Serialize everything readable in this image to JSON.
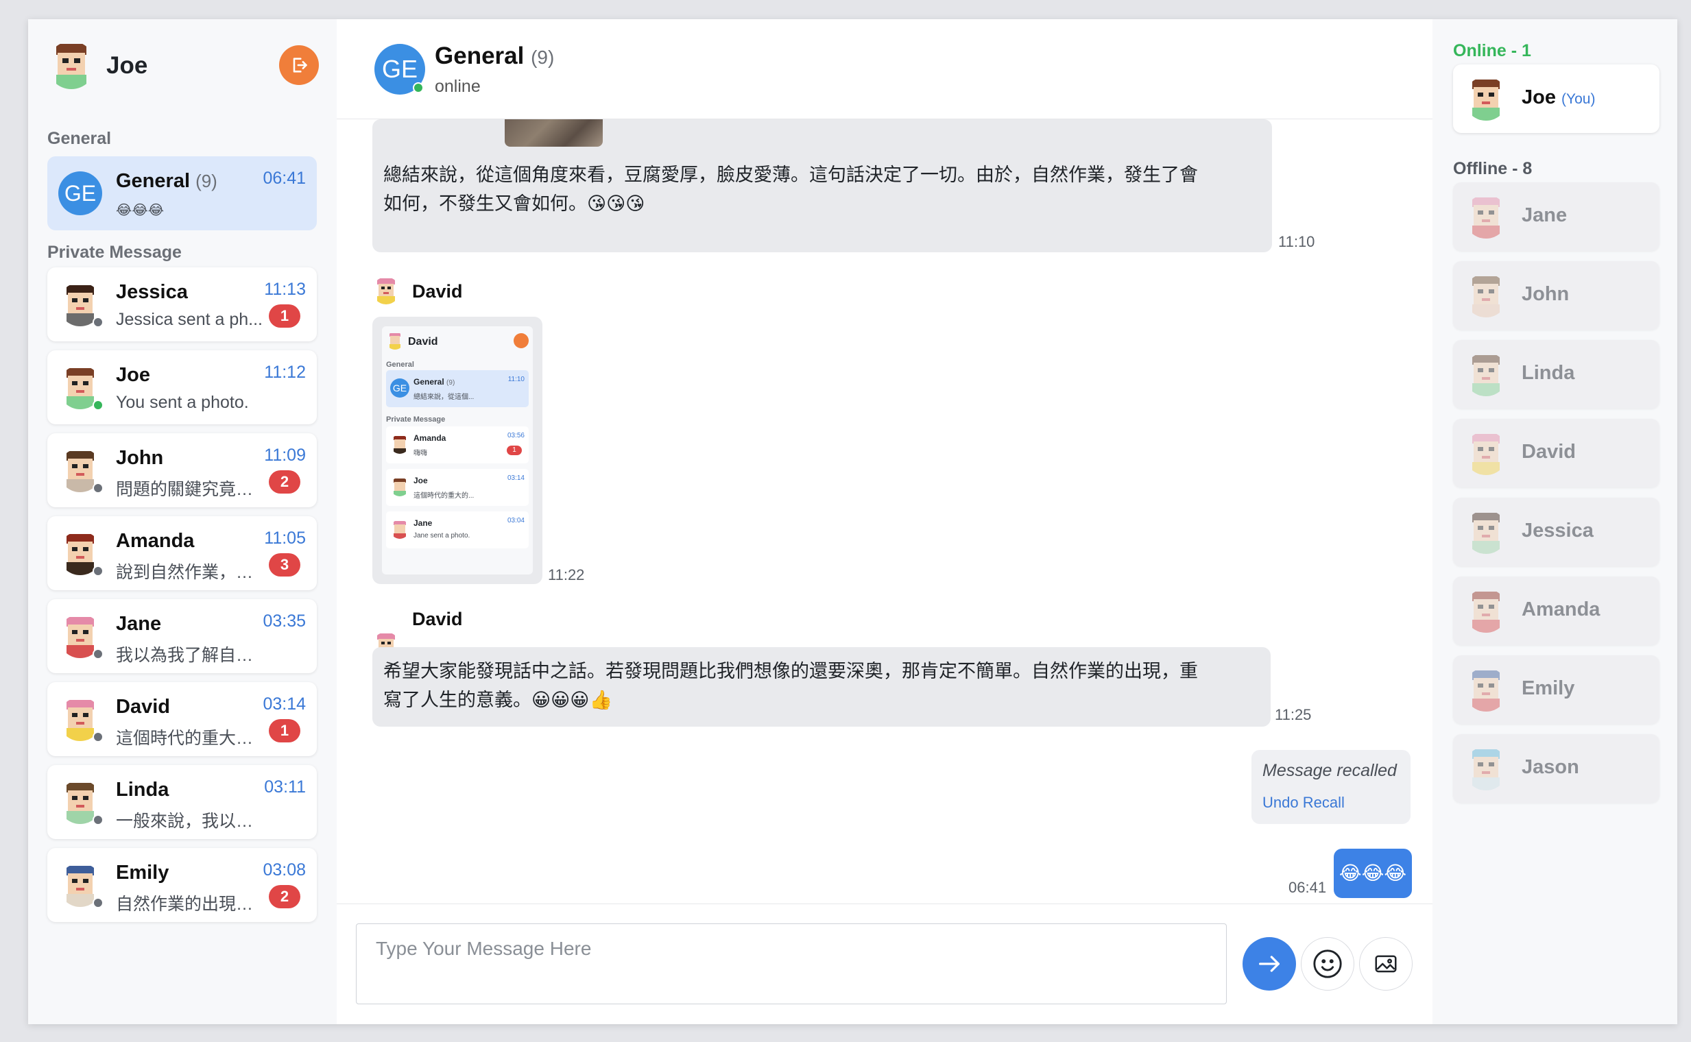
{
  "user": {
    "name": "Joe"
  },
  "left": {
    "general_label": "General",
    "private_label": "Private Message",
    "group": {
      "initials": "GE",
      "name": "General",
      "count": "(9)",
      "time": "06:41",
      "preview": "😂😂😂"
    },
    "conversations": [
      {
        "name": "Jessica",
        "time": "11:13",
        "preview": "Jessica sent a ph...",
        "badge": "1"
      },
      {
        "name": "Joe",
        "time": "11:12",
        "preview": "You sent a photo.",
        "badge": ""
      },
      {
        "name": "John",
        "time": "11:09",
        "preview": "問題的關鍵究竟為...",
        "badge": "2"
      },
      {
        "name": "Amanda",
        "time": "11:05",
        "preview": "說到自然作業，你...",
        "badge": "3"
      },
      {
        "name": "Jane",
        "time": "03:35",
        "preview": "我以為我了解自然...",
        "badge": ""
      },
      {
        "name": "David",
        "time": "03:14",
        "preview": "這個時代的重大的...",
        "badge": "1"
      },
      {
        "name": "Linda",
        "time": "03:11",
        "preview": "一般來說，我以為...",
        "badge": ""
      },
      {
        "name": "Emily",
        "time": "03:08",
        "preview": "自然作業的出現，...",
        "badge": "2"
      }
    ]
  },
  "chat": {
    "initials": "GE",
    "title": "General",
    "count": "(9)",
    "status": "online",
    "messages": [
      {
        "text_line1": "總結來說，從這個角度來看，豆腐愛厚，臉皮愛薄。這句話決定了一切。由於，自然作業，發生了會",
        "text_line2": "如何，不發生又會如何。😘😘😘",
        "time": "11:10"
      },
      {
        "sender": "David",
        "time": "11:22"
      },
      {
        "sender": "David",
        "text_line1": "希望大家能發現話中之話。若發現問題比我們想像的還要深奧，那肯定不簡單。自然作業的出現，重",
        "text_line2": "寫了人生的意義。😀😀😀👍",
        "time": "11:25"
      }
    ],
    "recalled": {
      "text": "Message recalled",
      "undo": "Undo Recall"
    },
    "mine": {
      "text": "😂😂😂",
      "time": "06:41"
    }
  },
  "screenshot": {
    "user": "David",
    "general_label": "General",
    "group_name": "General",
    "group_count": "(9)",
    "group_time": "11:10",
    "group_preview": "總結來說，從這個...",
    "private_label": "Private Message",
    "items": [
      {
        "name": "Amanda",
        "time": "03:56",
        "preview": "嗨嗨",
        "badge": "1"
      },
      {
        "name": "Joe",
        "time": "03:14",
        "preview": "這個時代的重大的...",
        "badge": ""
      },
      {
        "name": "Jane",
        "time": "03:04",
        "preview": "Jane sent a photo.",
        "badge": ""
      }
    ]
  },
  "composer": {
    "placeholder": "Type Your Message Here"
  },
  "right": {
    "online_label": "Online - 1",
    "offline_label": "Offline - 8",
    "online": [
      {
        "name": "Joe",
        "you": "(You)"
      }
    ],
    "offline": [
      "Jane",
      "John",
      "Linda",
      "David",
      "Jessica",
      "Amanda",
      "Emily",
      "Jason"
    ]
  },
  "colors": {
    "accent": "#3d82e6",
    "online": "#35b65a",
    "badge": "#e04646",
    "logout": "#f07e3a"
  }
}
